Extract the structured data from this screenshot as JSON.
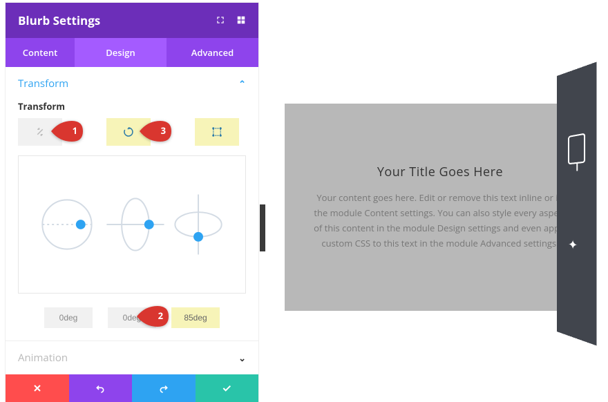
{
  "header": {
    "title": "Blurb Settings"
  },
  "tabs": {
    "content": "Content",
    "design": "Design",
    "advanced": "Advanced",
    "active": "design"
  },
  "sections": {
    "transform": {
      "title": "Transform",
      "label": "Transform"
    },
    "animation": {
      "title": "Animation"
    }
  },
  "degrees": {
    "v1": "0deg",
    "v2": "0deg",
    "v3": "85deg"
  },
  "callouts": {
    "c1": "1",
    "c2": "2",
    "c3": "3"
  },
  "preview": {
    "title": "Your Title Goes Here",
    "body": "Your content goes here. Edit or remove this text inline or in the module Content settings. You can also style every aspect of this content in the module Design settings and even apply custom CSS to this text in the module Advanced settings."
  },
  "colors": {
    "accent": "#2ea3f2"
  }
}
